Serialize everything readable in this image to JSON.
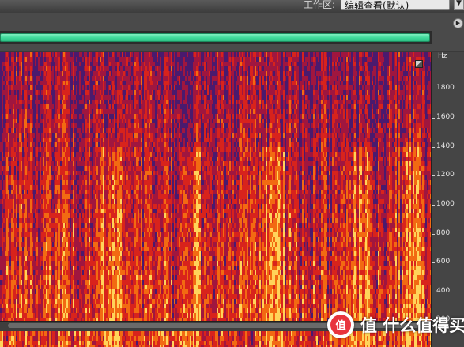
{
  "toolbar": {
    "workspace_label": "工作区:",
    "workspace_value": "编辑查看(默认)",
    "dropdown_glyph": "▼"
  },
  "panel": {
    "menu_glyph": "▶"
  },
  "spectral_display": {
    "unit": "Hz",
    "ticks": [
      "1800",
      "1600",
      "1400",
      "1200",
      "1000",
      "800",
      "600",
      "400",
      "200"
    ],
    "colors": {
      "low": "#4a1a6e",
      "mid_low": "#a0163f",
      "mid": "#d8231c",
      "mid_high": "#f26a12",
      "high": "#ffd45a"
    }
  },
  "overview": {
    "accent": "#3ed99a"
  },
  "watermark": {
    "text": "值 什么值得买",
    "logo_glyph": "值"
  }
}
